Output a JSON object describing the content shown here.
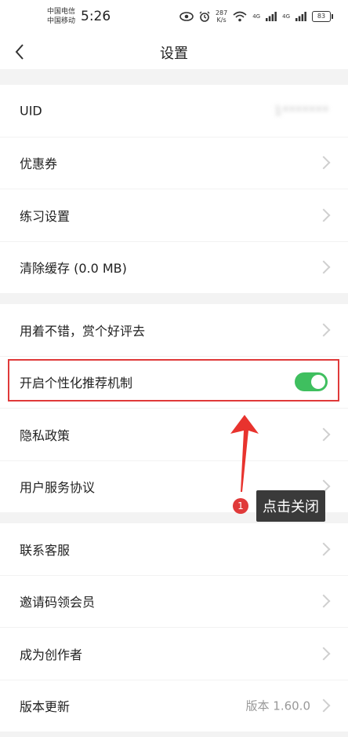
{
  "status_bar": {
    "carrier_1": "中国电信",
    "carrier_2": "中国移动",
    "time": "5:26",
    "speed_value": "287",
    "speed_unit": "K/s",
    "network_1": "4G",
    "network_2": "4G",
    "battery": "83"
  },
  "nav": {
    "title": "设置"
  },
  "groups": [
    {
      "rows": [
        {
          "label": "UID",
          "value": "1*******",
          "value_blurred": true
        },
        {
          "label": "优惠券"
        },
        {
          "label": "练习设置"
        },
        {
          "label": "清除缓存 (0.0 MB)"
        }
      ]
    },
    {
      "rows": [
        {
          "label": "用着不错，赏个好评去"
        },
        {
          "label": "开启个性化推荐机制",
          "toggle_on": true
        },
        {
          "label": "隐私政策"
        },
        {
          "label": "用户服务协议"
        }
      ]
    },
    {
      "rows": [
        {
          "label": "联系客服"
        },
        {
          "label": "邀请码领会员"
        },
        {
          "label": "成为创作者"
        },
        {
          "label": "版本更新",
          "value": "版本 1.60.0"
        }
      ]
    }
  ],
  "annotation": {
    "step_number": "1",
    "text": "点击关闭"
  },
  "colors": {
    "toggle_on": "#3fbf5f",
    "highlight": "#e03a3a",
    "background": "#f3f3f3"
  }
}
